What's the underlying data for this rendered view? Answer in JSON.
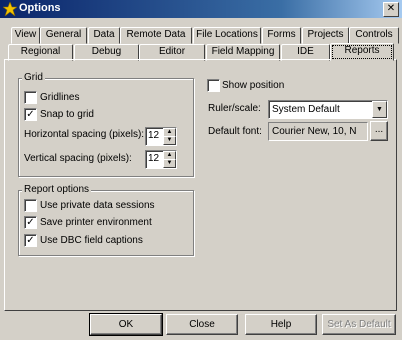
{
  "window": {
    "title": "Options",
    "close_glyph": "✕"
  },
  "tabs_row1": [
    "View",
    "General",
    "Data",
    "Remote Data",
    "File Locations",
    "Forms",
    "Projects",
    "Controls"
  ],
  "tabs_row2": [
    "Regional",
    "Debug",
    "Editor",
    "Field Mapping",
    "IDE",
    "Reports"
  ],
  "active_tab": "Reports",
  "grid": {
    "group_label": "Grid",
    "gridlines": {
      "label": "Gridlines",
      "checked": false
    },
    "snap_to_grid": {
      "label": "Snap to grid",
      "checked": true
    },
    "horizontal_spacing": {
      "label": "Horizontal spacing (pixels):",
      "value": "12"
    },
    "vertical_spacing": {
      "label": "Vertical spacing (pixels):",
      "value": "12"
    }
  },
  "show_position": {
    "label": "Show position",
    "checked": false
  },
  "ruler_scale": {
    "label": "Ruler/scale:",
    "value": "System Default"
  },
  "default_font": {
    "label": "Default font:",
    "value": "Courier New, 10, N",
    "browse_label": "..."
  },
  "report_options": {
    "group_label": "Report options",
    "private_sessions": {
      "label": "Use private data sessions",
      "checked": false
    },
    "save_printer": {
      "label": "Save printer environment",
      "checked": true
    },
    "dbc_captions": {
      "label": "Use DBC field captions",
      "checked": true
    }
  },
  "buttons": {
    "ok": "OK",
    "close": "Close",
    "help": "Help",
    "set_as_default": "Set As Default"
  },
  "icons": {
    "app": "star-icon",
    "close": "close-icon",
    "spin_up": "arrow-up-icon",
    "spin_down": "arrow-down-icon",
    "dropdown": "chevron-down-icon"
  }
}
